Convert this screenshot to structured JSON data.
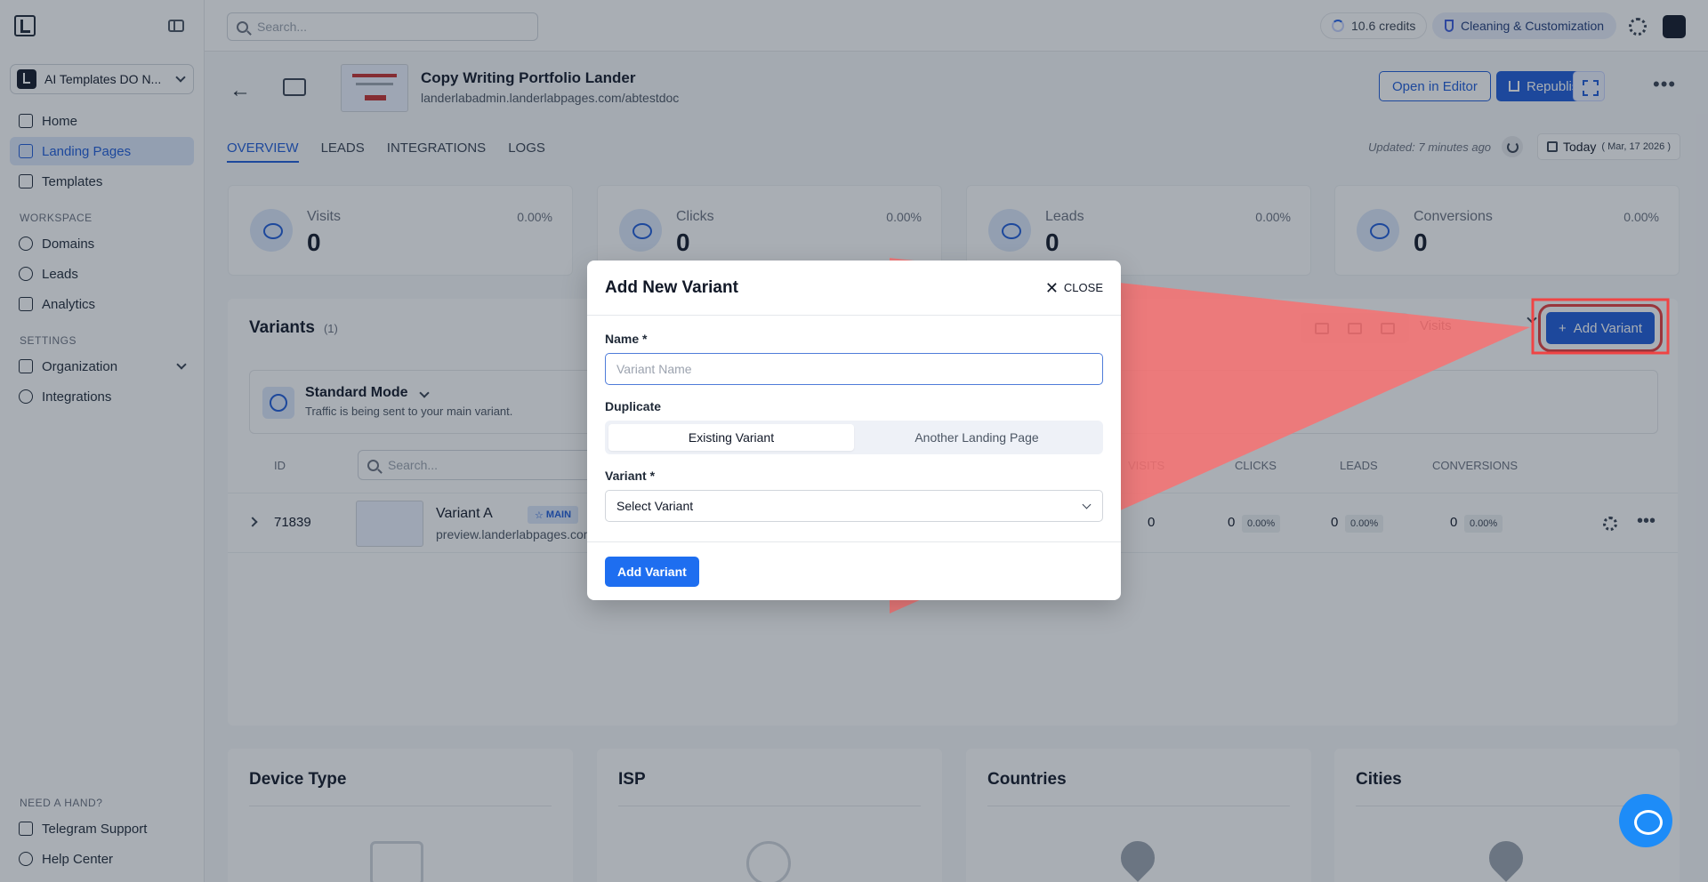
{
  "org": {
    "name": "AI Templates DO N..."
  },
  "sidebar": {
    "main_items": [
      {
        "label": "Home",
        "icon": "home-icon"
      },
      {
        "label": "Landing Pages",
        "icon": "pages-icon",
        "active": true
      },
      {
        "label": "Templates",
        "icon": "templates-icon"
      }
    ],
    "workspace_label": "WORKSPACE",
    "workspace_items": [
      {
        "label": "Domains",
        "icon": "globe-icon"
      },
      {
        "label": "Leads",
        "icon": "users-icon"
      },
      {
        "label": "Analytics",
        "icon": "chart-icon"
      }
    ],
    "settings_label": "SETTINGS",
    "settings_items": [
      {
        "label": "Organization",
        "icon": "building-icon"
      },
      {
        "label": "Integrations",
        "icon": "link-icon"
      }
    ],
    "help_label": "NEED A HAND?",
    "help_items": [
      {
        "label": "Telegram Support",
        "icon": "send-icon"
      },
      {
        "label": "Help Center",
        "icon": "help-icon"
      }
    ]
  },
  "topbar": {
    "search_placeholder": "Search...",
    "credits": "10.6 credits",
    "cleaning": "Cleaning & Customization"
  },
  "page": {
    "title": "Copy Writing Portfolio Lander",
    "url": "landerlabadmin.landerlabpages.com/abtestdoc",
    "open_editor": "Open in Editor",
    "republish": "Republish"
  },
  "tabs": [
    "OVERVIEW",
    "LEADS",
    "INTEGRATIONS",
    "LOGS"
  ],
  "status": {
    "updated": "Updated: 7 minutes ago",
    "date_label": "Today",
    "date_detail": "( Mar, 17 2026 )"
  },
  "stats": [
    {
      "label": "Visits",
      "value": "0",
      "pct": "0.00%"
    },
    {
      "label": "Clicks",
      "value": "0",
      "pct": "0.00%"
    },
    {
      "label": "Leads",
      "value": "0",
      "pct": "0.00%"
    },
    {
      "label": "Conversions",
      "value": "0",
      "pct": "0.00%"
    }
  ],
  "variants": {
    "title": "Variants",
    "count": "(1)",
    "metric": "Visits",
    "add_label": "Add Variant",
    "mode_title": "Standard Mode",
    "mode_sub": "Traffic is being sent to your main variant.",
    "search_placeholder": "Search...",
    "columns": {
      "id": "ID",
      "visits": "VISITS",
      "clicks": "CLICKS",
      "leads": "LEADS",
      "conversions": "CONVERSIONS"
    },
    "row": {
      "id": "71839",
      "name": "Variant A",
      "badge": "MAIN",
      "url": "preview.landerlabpages.com",
      "visits": "0",
      "clicks": "0",
      "clicks_pct": "0.00%",
      "leads": "0",
      "leads_pct": "0.00%",
      "conversions": "0",
      "conversions_pct": "0.00%"
    }
  },
  "bottom_cards": [
    "Device Type",
    "ISP",
    "Countries",
    "Cities"
  ],
  "modal": {
    "title": "Add New Variant",
    "close": "CLOSE",
    "name_label": "Name *",
    "name_placeholder": "Variant Name",
    "duplicate_label": "Duplicate",
    "dup_options": [
      "Existing Variant",
      "Another Landing Page"
    ],
    "variant_label": "Variant *",
    "variant_select": "Select Variant",
    "submit": "Add Variant"
  },
  "colors": {
    "accent": "#1e5bd8",
    "highlight": "#e53e3e"
  }
}
